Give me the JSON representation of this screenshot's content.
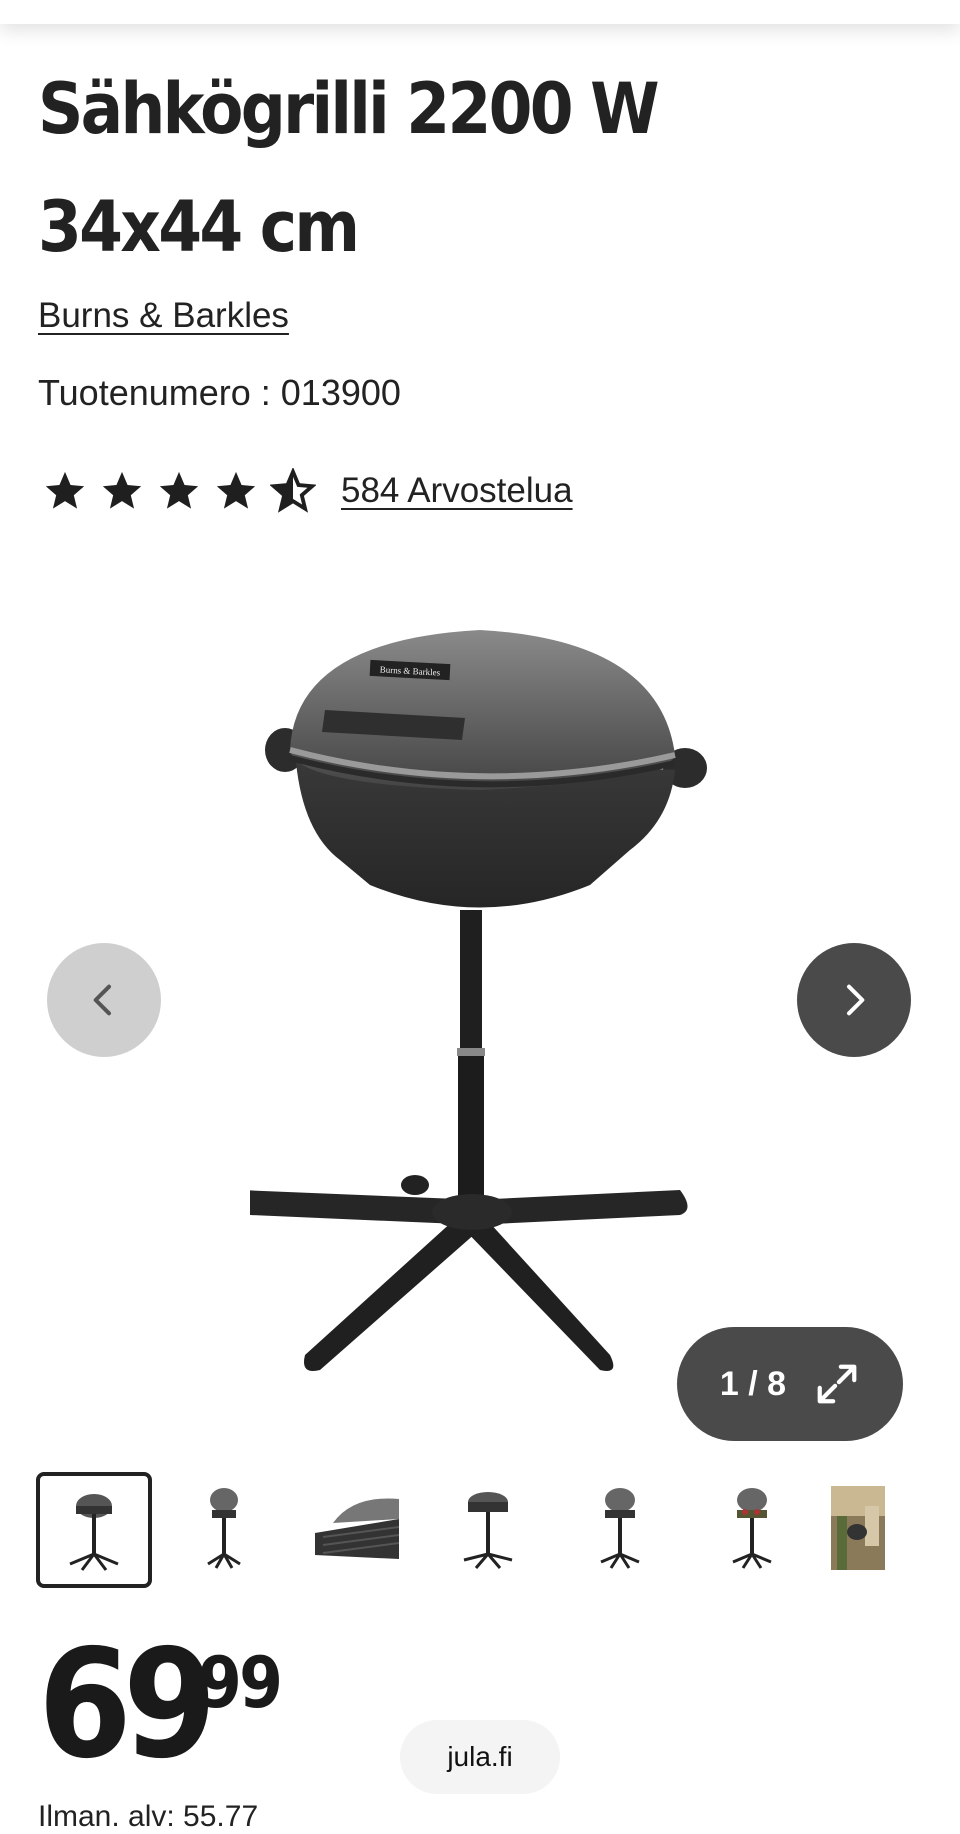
{
  "product": {
    "title_line1": "Sähkögrilli 2200 W",
    "title_line2": "34x44 cm",
    "brand": "Burns & Barkles",
    "sku_text": "Tuotenumero : 013900",
    "rating": 4.5,
    "rating_max": 5,
    "reviews_text": "584 Arvostelua",
    "grill_lid_brand": "Burns & Barkles"
  },
  "gallery": {
    "counter": "1 / 8",
    "thumbnails": [
      "grill-front",
      "grill-open",
      "grill-detail",
      "grill-side",
      "grill-variant",
      "grill-food",
      "grill-lifestyle"
    ]
  },
  "price": {
    "main": "69",
    "cents": "99",
    "vat_text": "Ilman. alv: 55.77"
  },
  "browser": {
    "domain": "jula.fi"
  },
  "colors": {
    "text": "#222222",
    "nav_active": "#4a4a4a",
    "nav_inactive": "#cfcfcf"
  }
}
